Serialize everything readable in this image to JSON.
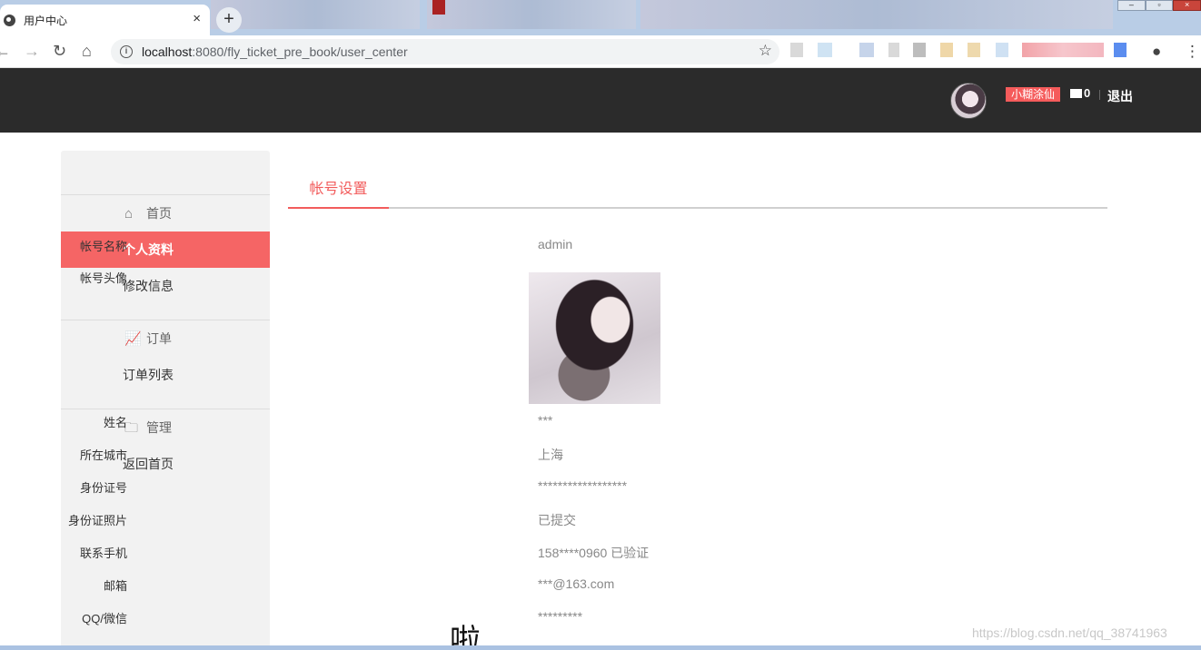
{
  "browser": {
    "tab_title": "用户中心",
    "tab_close": "×",
    "new_tab": "+",
    "url_host": "localhost",
    "url_rest": ":8080/fly_ticket_pre_book/user_center"
  },
  "header": {
    "username": "小糊涂仙",
    "mail_count": "0",
    "logout": "退出"
  },
  "sidebar": {
    "groups": [
      {
        "title": "首页",
        "items": [
          "个人资料",
          "修改信息"
        ]
      },
      {
        "title": "订单",
        "items": [
          "订单列表"
        ]
      },
      {
        "title": "管理",
        "items": [
          "返回首页"
        ]
      }
    ]
  },
  "main": {
    "tab": "帐号设置",
    "fields": [
      {
        "label": "帐号名称",
        "value": "admin"
      },
      {
        "label": "帐号头像",
        "value": ""
      },
      {
        "label": "姓名",
        "value": "***"
      },
      {
        "label": "所在城市",
        "value": "上海"
      },
      {
        "label": "身份证号",
        "value": "******************"
      },
      {
        "label": "身份证照片",
        "value": "已提交"
      },
      {
        "label": "联系手机",
        "value": "158****0960 已验证"
      },
      {
        "label": "邮箱",
        "value": "***@163.com"
      },
      {
        "label": "QQ/微信",
        "value": "*********"
      }
    ]
  },
  "overlay": {
    "text": "啦",
    "dots": "。。。。。。"
  },
  "watermark": "https://blog.csdn.net/qq_38741963",
  "colors": {
    "accent": "#f56565",
    "header_bg": "#2b2b2b",
    "sidebar_bg": "#f2f2f2"
  }
}
